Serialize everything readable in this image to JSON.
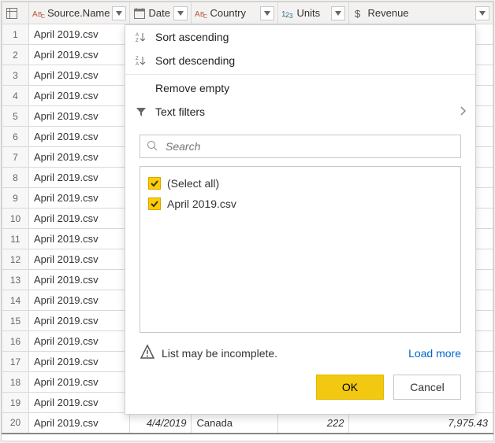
{
  "columns": {
    "source_name": "Source.Name",
    "date": "Date",
    "country": "Country",
    "units": "Units",
    "revenue": "Revenue"
  },
  "row_value": "April 2019.csv",
  "row_count": 20,
  "visible_data_row": {
    "date": "4/4/2019",
    "country": "Canada",
    "units": "222",
    "revenue": "7,975.43"
  },
  "filter_menu": {
    "sort_asc": "Sort ascending",
    "sort_desc": "Sort descending",
    "remove_empty": "Remove empty",
    "text_filters": "Text filters",
    "search_placeholder": "Search",
    "select_all": "(Select all)",
    "item1": "April 2019.csv",
    "warning": "List may be incomplete.",
    "load_more": "Load more",
    "ok": "OK",
    "cancel": "Cancel"
  }
}
